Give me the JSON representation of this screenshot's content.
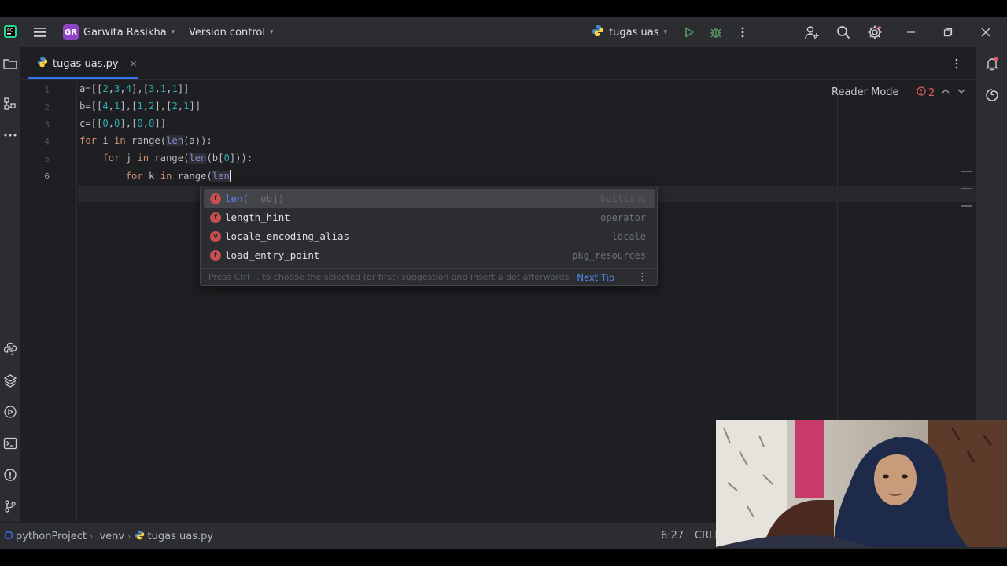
{
  "titlebar": {
    "project_initials": "GR",
    "project_name": "Garwita Rasikha",
    "version_control": "Version control",
    "run_config": "tugas uas"
  },
  "tab": {
    "label": "tugas uas.py",
    "close": "×"
  },
  "editor": {
    "line_numbers": [
      "1",
      "2",
      "3",
      "4",
      "5",
      "6"
    ],
    "reader_mode": "Reader Mode",
    "error_count": "2"
  },
  "completion": {
    "items": [
      {
        "name": "len",
        "param": "(__obj)",
        "source": "builtins"
      },
      {
        "name": "length_hint",
        "param": "",
        "source": "operator"
      },
      {
        "name": "locale_encoding_alias",
        "param": "",
        "source": "locale"
      },
      {
        "name": "load_entry_point",
        "param": "",
        "source": "pkg_resources"
      }
    ],
    "hint": "Press Ctrl+. to choose the selected (or first) suggestion and insert a dot afterwards",
    "next_tip": "Next Tip"
  },
  "statusbar": {
    "project": "pythonProject",
    "venv": ".venv",
    "file": "tugas uas.py",
    "position": "6:27",
    "line_ending": "CRLF"
  },
  "colors": {
    "accent": "#3574f0",
    "error": "#c94f4f",
    "keyword": "#cf8e6d",
    "number": "#2aacb8",
    "builtin": "#8888c6"
  }
}
